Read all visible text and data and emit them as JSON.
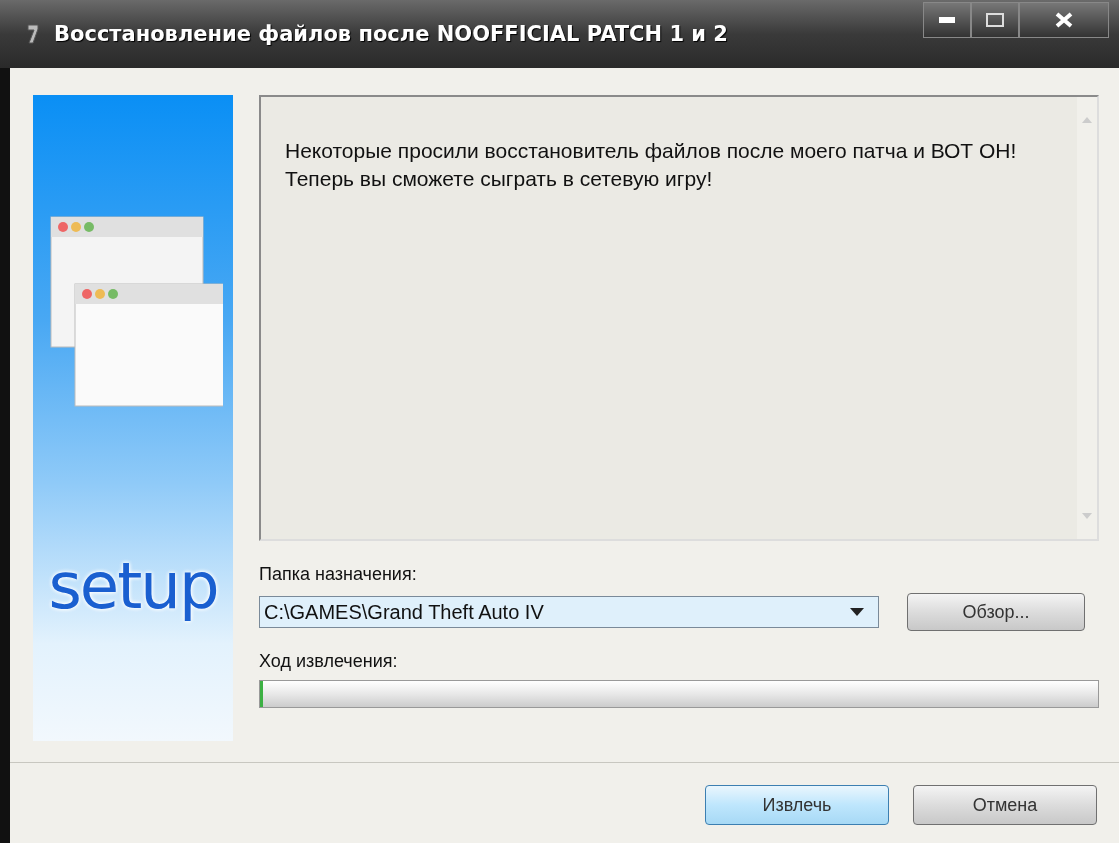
{
  "window": {
    "title": "Восстановление файлов после NOOFFICIAL PATCH 1 и 2"
  },
  "banner": {
    "logo": "setup"
  },
  "message": "Некоторые просили восстановитель файлов после моего патча и ВОТ ОН! Теперь вы сможете сыграть в сетевую игру!",
  "destination": {
    "label": "Папка назначения:",
    "value": "C:\\GAMES\\Grand Theft Auto IV",
    "browse_button": "Обзор..."
  },
  "progress": {
    "label": "Ход извлечения:",
    "level": 0.004
  },
  "buttons": [
    {
      "label": "Извлечь",
      "selected": true
    },
    {
      "label": "Отмена",
      "selected": false
    }
  ]
}
